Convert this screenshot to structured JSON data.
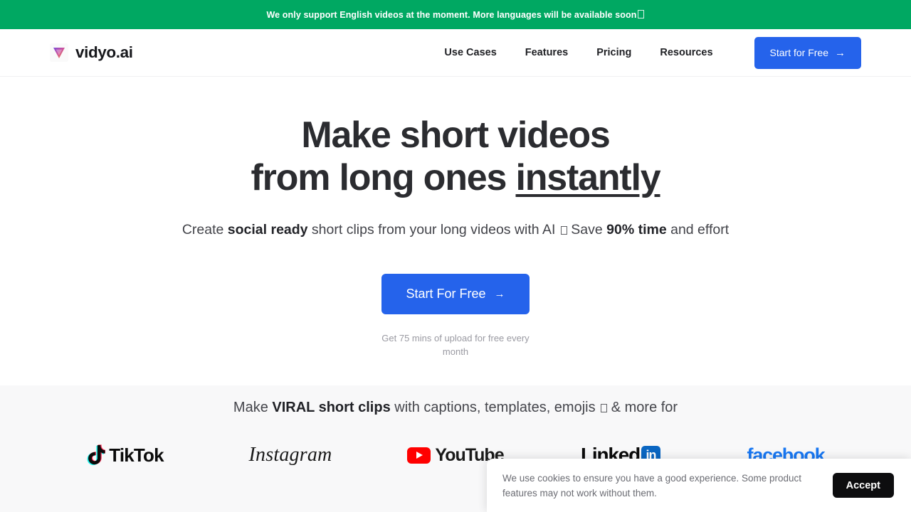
{
  "announcement": {
    "text": "We only support English videos at the moment. More languages will be available soon",
    "emoji_placeholder": "tofu-box",
    "background_color": "#00a862",
    "text_color": "#ffffff"
  },
  "header": {
    "logo_icon": "vidyo-triangle-logo",
    "brand_name": "vidyo.ai",
    "nav_items": [
      {
        "label": "Use Cases"
      },
      {
        "label": "Features"
      },
      {
        "label": "Pricing"
      },
      {
        "label": "Resources"
      }
    ],
    "cta": {
      "label": "Start for Free",
      "arrow": "→",
      "background_color": "#2563eb"
    }
  },
  "hero": {
    "title_line1": "Make short videos",
    "title_line2_prefix": "from long ones ",
    "title_line2_underlined": "instantly",
    "subtitle": {
      "part1": "Create ",
      "bold1": "social ready",
      "part2": " short clips from your long videos with AI ",
      "emoji_placeholder": "tofu-box",
      "part3": " Save ",
      "bold2": "90% time",
      "part4": " and effort"
    },
    "cta": {
      "label": "Start For Free",
      "arrow": "→",
      "background_color": "#2563eb"
    },
    "note": "Get 75 mins of upload for free every month"
  },
  "social_proof": {
    "headline": {
      "part1": "Make ",
      "bold1": "VIRAL short clips",
      "part2": " with captions, templates, emojis ",
      "emoji_placeholder": "tofu-box",
      "part3": " & more for"
    },
    "logos": [
      {
        "name": "TikTok",
        "wordmark": "TikTok",
        "color": "#0b0b0b"
      },
      {
        "name": "Instagram",
        "wordmark": "Instagram",
        "color": "#1a1a1a"
      },
      {
        "name": "YouTube",
        "wordmark": "YouTube",
        "color": "#ff0000"
      },
      {
        "name": "LinkedIn",
        "wordmark": "Linked",
        "badge": "in",
        "color": "#0a66c2"
      },
      {
        "name": "facebook",
        "wordmark": "facebook",
        "color": "#1877f2"
      }
    ],
    "background_color": "#f8f8f9"
  },
  "cookie_banner": {
    "message": "We use cookies to ensure you have a good experience. Some product features may not work without them.",
    "accept_label": "Accept",
    "accept_background": "#0d0d0f"
  }
}
